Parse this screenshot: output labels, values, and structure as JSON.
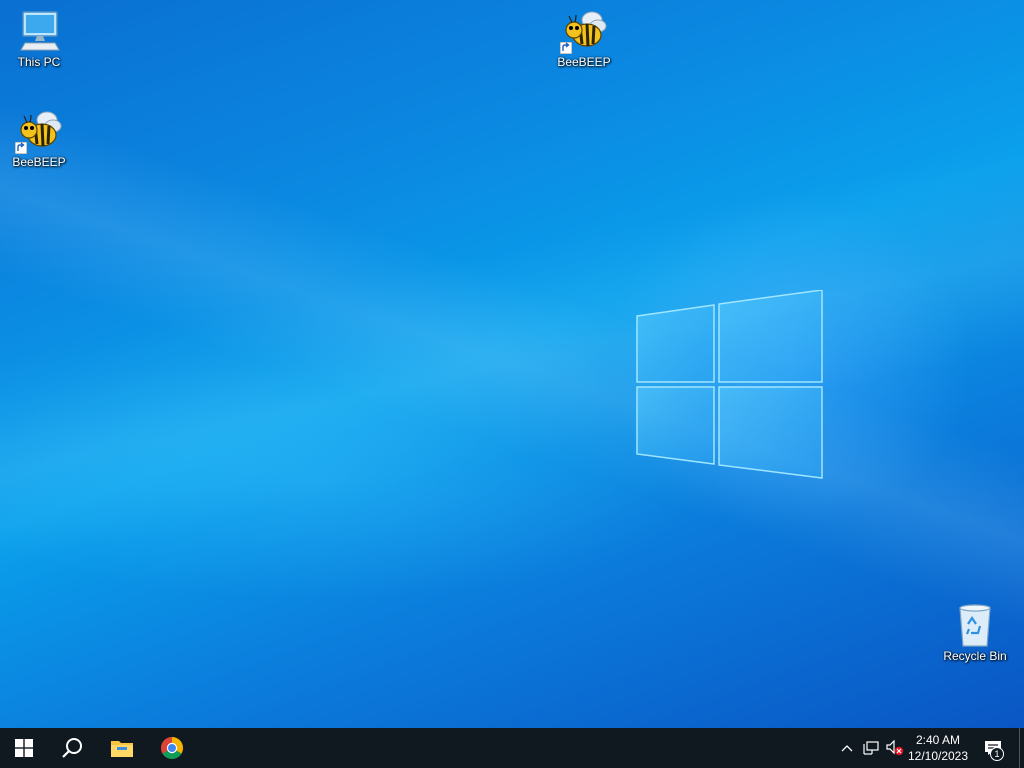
{
  "desktop": {
    "icons": [
      {
        "label": "This PC",
        "icon": "computer-icon"
      },
      {
        "label": "BeeBEEP",
        "icon": "beebeep-bee-icon",
        "shortcut": true
      },
      {
        "label": "BeeBEEP",
        "icon": "beebeep-bee-icon",
        "shortcut": true
      },
      {
        "label": "Recycle Bin",
        "icon": "recycle-bin-icon"
      }
    ]
  },
  "taskbar": {
    "buttons": [
      {
        "name": "start-button",
        "icon": "windows-logo-icon"
      },
      {
        "name": "search-button",
        "icon": "search-icon"
      },
      {
        "name": "file-explorer-button",
        "icon": "folder-icon"
      },
      {
        "name": "chrome-button",
        "icon": "chrome-icon"
      }
    ],
    "tray": {
      "chevron_icon": "chevron-up-icon",
      "network_icon": "network-icon",
      "volume_icon": "volume-muted-icon"
    },
    "clock": {
      "time": "2:40 AM",
      "date": "12/10/2023"
    },
    "notifications": {
      "icon": "action-center-icon",
      "count": "1"
    }
  },
  "colors": {
    "taskbar_bg": "#101820",
    "desktop_mid": "#0aa0ec",
    "desktop_dark": "#0a56c4"
  }
}
